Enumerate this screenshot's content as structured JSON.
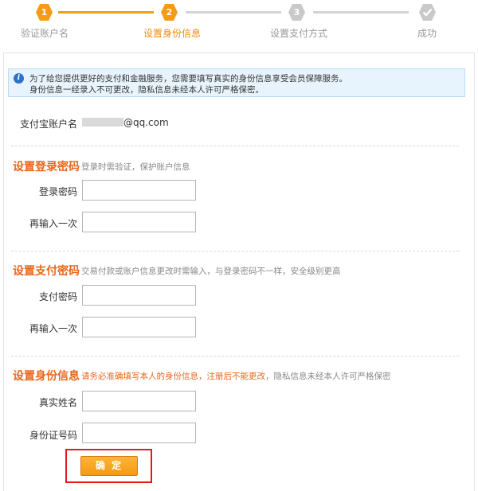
{
  "stepper": {
    "steps": [
      {
        "number": "1",
        "label": "验证账户名",
        "state": "done"
      },
      {
        "number": "2",
        "label": "设置身份信息",
        "state": "active"
      },
      {
        "number": "3",
        "label": "设置支付方式",
        "state": "pending"
      },
      {
        "number": "",
        "label": "成功",
        "state": "pending"
      }
    ],
    "colors": {
      "active": "#f59b16",
      "pending": "#c9c9c9",
      "active_label": "#f08a0e",
      "pending_label": "#999999"
    }
  },
  "notice": {
    "icon": "info-icon",
    "icon_glyph": "i",
    "line1": "为了给您提供更好的支付和金融服务，您需要填写真实的身份信息享受会员保障服务。",
    "line2": "身份信息一经录入不可更改，隐私信息未经本人许可严格保密。"
  },
  "account": {
    "label": "支付宝账户名",
    "value_suffix": "@qq.com"
  },
  "login_password": {
    "title": "设置登录密码",
    "hint": "登录时需验证，保护账户信息",
    "fields": [
      {
        "label": "登录密码",
        "value": ""
      },
      {
        "label": "再输入一次",
        "value": ""
      }
    ]
  },
  "pay_password": {
    "title": "设置支付密码",
    "hint": "交易付款或账户信息更改时需输入，与登录密码不一样，安全级别更高",
    "fields": [
      {
        "label": "支付密码",
        "value": ""
      },
      {
        "label": "再输入一次",
        "value": ""
      }
    ]
  },
  "identity": {
    "title": "设置身份信息",
    "hint_warn": "请务必准确填写本人的身份信息，注册后不能更改",
    "hint_rest": "，隐私信息未经本人许可严格保密",
    "fields": [
      {
        "label": "真实姓名",
        "value": ""
      },
      {
        "label": "身份证号码",
        "value": ""
      }
    ]
  },
  "confirm": {
    "label": "确 定"
  }
}
